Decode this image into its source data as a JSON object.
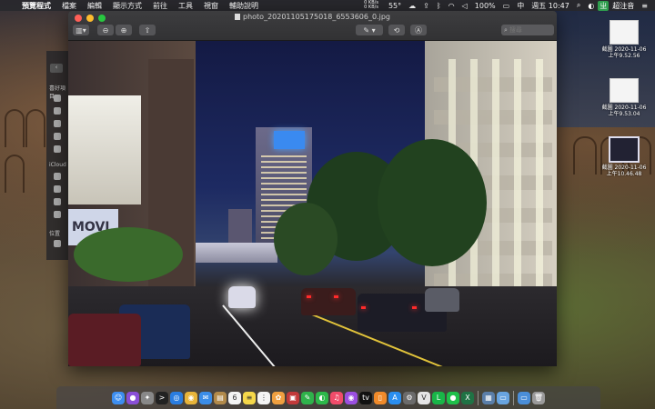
{
  "menubar": {
    "app_name": "預覽程式",
    "items": [
      "檔案",
      "編輯",
      "顯示方式",
      "前往",
      "工具",
      "視窗",
      "輔助說明"
    ],
    "net_up": "0 KB/s",
    "net_down": "0 KB/s",
    "temperature": "55°",
    "battery": "100%",
    "input_method": "中",
    "clock": "週五 10:47",
    "app_label": "超注音"
  },
  "window": {
    "title": "photo_20201105175018_6553606_0.jpg",
    "search_placeholder": "搜尋"
  },
  "sidebar": {
    "labels": [
      "喜好項目",
      "iCloud",
      "位置"
    ]
  },
  "desktop": {
    "items": [
      {
        "line1": "截圖 2020-11-06",
        "line2": "上午9.52.56"
      },
      {
        "line1": "截圖 2020-11-06",
        "line2": "上午9.53.04"
      },
      {
        "line1": "截圖 2020-11-06",
        "line2": "上午10.46.48"
      }
    ]
  },
  "dock": {
    "icons": [
      {
        "name": "finder-icon",
        "color": "#3d8ef0",
        "glyph": "☺"
      },
      {
        "name": "siri-icon",
        "color": "#8a4fd6",
        "glyph": "●"
      },
      {
        "name": "launchpad-icon",
        "color": "#888888",
        "glyph": "✦"
      },
      {
        "name": "terminal-icon",
        "color": "#222222",
        "glyph": ">"
      },
      {
        "name": "safari-icon",
        "color": "#2a7de1",
        "glyph": "◎"
      },
      {
        "name": "chrome-icon",
        "color": "#e8b43a",
        "glyph": "◉"
      },
      {
        "name": "mail-icon",
        "color": "#3b8de8",
        "glyph": "✉"
      },
      {
        "name": "notes-icon",
        "color": "#b28a4a",
        "glyph": "▤"
      },
      {
        "name": "calendar-icon",
        "color": "#f4f4f4",
        "glyph": "6"
      },
      {
        "name": "notes-yellow-icon",
        "color": "#f6d84a",
        "glyph": "≡"
      },
      {
        "name": "reminders-icon",
        "color": "#f4f4f4",
        "glyph": "⋮"
      },
      {
        "name": "photos-icon",
        "color": "#f0a040",
        "glyph": "✿"
      },
      {
        "name": "photo-booth-icon",
        "color": "#c23a3a",
        "glyph": "▣"
      },
      {
        "name": "messages-icon",
        "color": "#2fb24b",
        "glyph": "✎"
      },
      {
        "name": "facetime-icon",
        "color": "#2db84a",
        "glyph": "◐"
      },
      {
        "name": "music-icon",
        "color": "#f04c6a",
        "glyph": "♫"
      },
      {
        "name": "podcasts-icon",
        "color": "#9b4fe0",
        "glyph": "◉"
      },
      {
        "name": "tv-icon",
        "color": "#111111",
        "glyph": "tv"
      },
      {
        "name": "books-icon",
        "color": "#f08a2a",
        "glyph": "▯"
      },
      {
        "name": "app-store-icon",
        "color": "#2a8ef0",
        "glyph": "A"
      },
      {
        "name": "system-preferences-icon",
        "color": "#6b6b6b",
        "glyph": "⚙"
      },
      {
        "name": "vectorize-icon",
        "color": "#e5e5e5",
        "glyph": "V"
      },
      {
        "name": "line-icon",
        "color": "#19b548",
        "glyph": "L"
      },
      {
        "name": "wechat-icon",
        "color": "#1fbf4a",
        "glyph": "●"
      },
      {
        "name": "excel-icon",
        "color": "#1f7244",
        "glyph": "X"
      },
      {
        "name": "preview-icon",
        "color": "#5a7ea8",
        "glyph": "▦"
      },
      {
        "name": "finder-folder-icon",
        "color": "#68a4e0",
        "glyph": "▭"
      },
      {
        "name": "downloads-folder-icon",
        "color": "#4a8ed8",
        "glyph": "▭"
      },
      {
        "name": "trash-icon",
        "color": "#9a9a9a",
        "glyph": "🗑"
      }
    ]
  }
}
